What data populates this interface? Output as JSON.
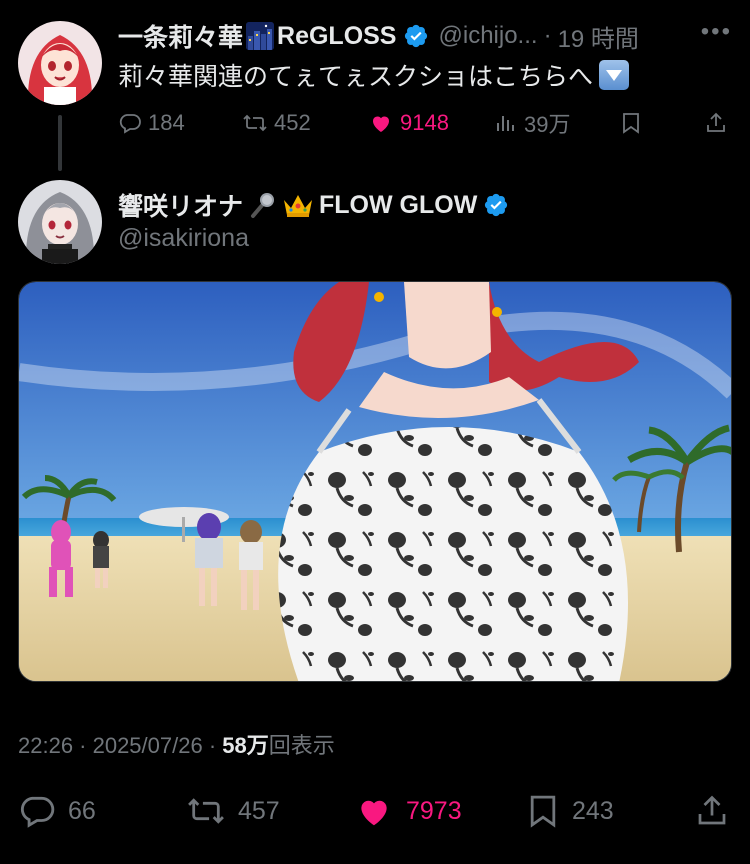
{
  "parent_tweet": {
    "author_name": "一条莉々華",
    "author_suffix": "ReGLOSS",
    "handle": "@ichijo...",
    "separator": "·",
    "time": "19 時間",
    "more_label": "•••",
    "text": "莉々華関連のてぇてぇスクショはこちらへ",
    "stats": {
      "replies": "184",
      "reposts": "452",
      "likes": "9148",
      "views": "39万"
    }
  },
  "tweet": {
    "author_name": "響咲リオナ",
    "author_suffix": "FLOW GLOW",
    "handle": "@isakiriona",
    "timestamp": "22:26 · 2025/07/26 · ",
    "view_count": "58万",
    "view_label": "回表示",
    "stats": {
      "replies": "66",
      "reposts": "457",
      "likes": "7973",
      "bookmarks": "243"
    }
  },
  "icons": [
    "reply-icon",
    "repost-icon",
    "heart-icon",
    "views-icon",
    "bookmark-icon",
    "share-icon",
    "verified-icon",
    "microphone-icon",
    "crown-icon"
  ],
  "colors": {
    "background": "#000000",
    "text": "#e7e9ea",
    "muted": "#71767b",
    "like": "#f91880",
    "verified": "#1d9bf0"
  }
}
